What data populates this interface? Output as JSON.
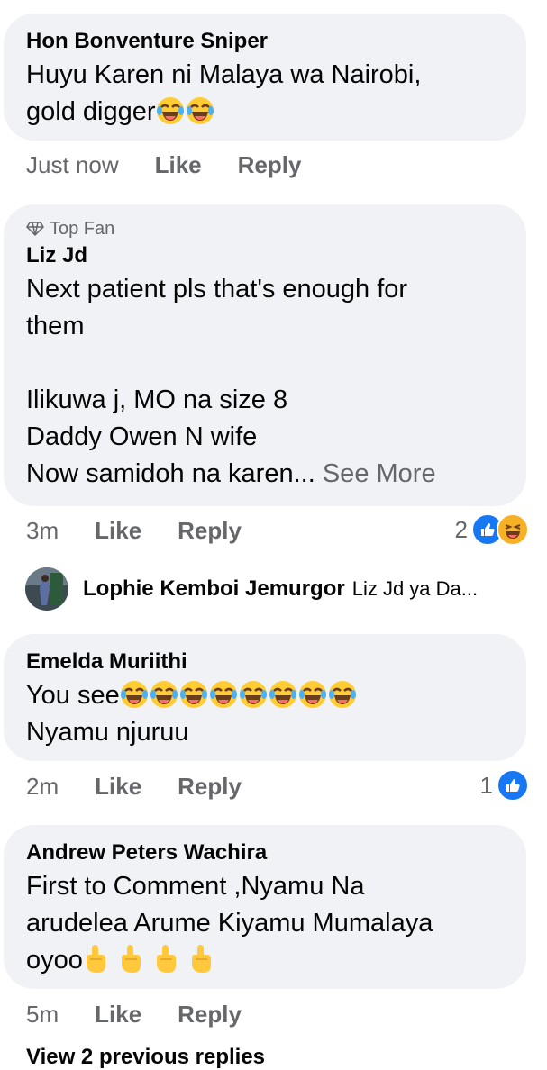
{
  "comments": [
    {
      "name": "Hon Bonventure Sniper",
      "text": "Huyu Karen ni Malaya wa Nairobi,\ngold digger",
      "time": "Just now",
      "like": "Like",
      "reply": "Reply"
    },
    {
      "badge": "Top Fan",
      "name": "Liz Jd",
      "text": "Next patient pls that's enough for\nthem\n\nIlikuwa j, MO na size 8\nDaddy Owen N wife\nNow samidoh na karen...",
      "see_more": "See More",
      "time": "3m",
      "like": "Like",
      "reply": "Reply",
      "reaction_count": "2"
    },
    {
      "name": "Emelda Muriithi",
      "text_line1": "You see",
      "text_line2": "Nyamu njuruu",
      "time": "2m",
      "like": "Like",
      "reply": "Reply",
      "reaction_count": "1"
    },
    {
      "name": "Andrew Peters Wachira",
      "text": "First to Comment ,Nyamu Na\narudelea Arume Kiyamu Mumalaya\noyoo",
      "time": "5m",
      "like": "Like",
      "reply": "Reply"
    }
  ],
  "nested_reply": {
    "name": "Lophie Kemboi Jemurgor",
    "preview": "Liz Jd ya Da..."
  },
  "view_previous": "View 2 previous replies",
  "icons": {
    "laugh": "laughing-tears-emoji",
    "like": "like-thumb-icon",
    "haha": "haha-reaction-icon",
    "finger": "pointing-finger-emoji",
    "diamond": "diamond-icon"
  },
  "colors": {
    "bubble": "#f0f2f5",
    "meta": "#65676b",
    "like_blue": "#1877f2"
  }
}
